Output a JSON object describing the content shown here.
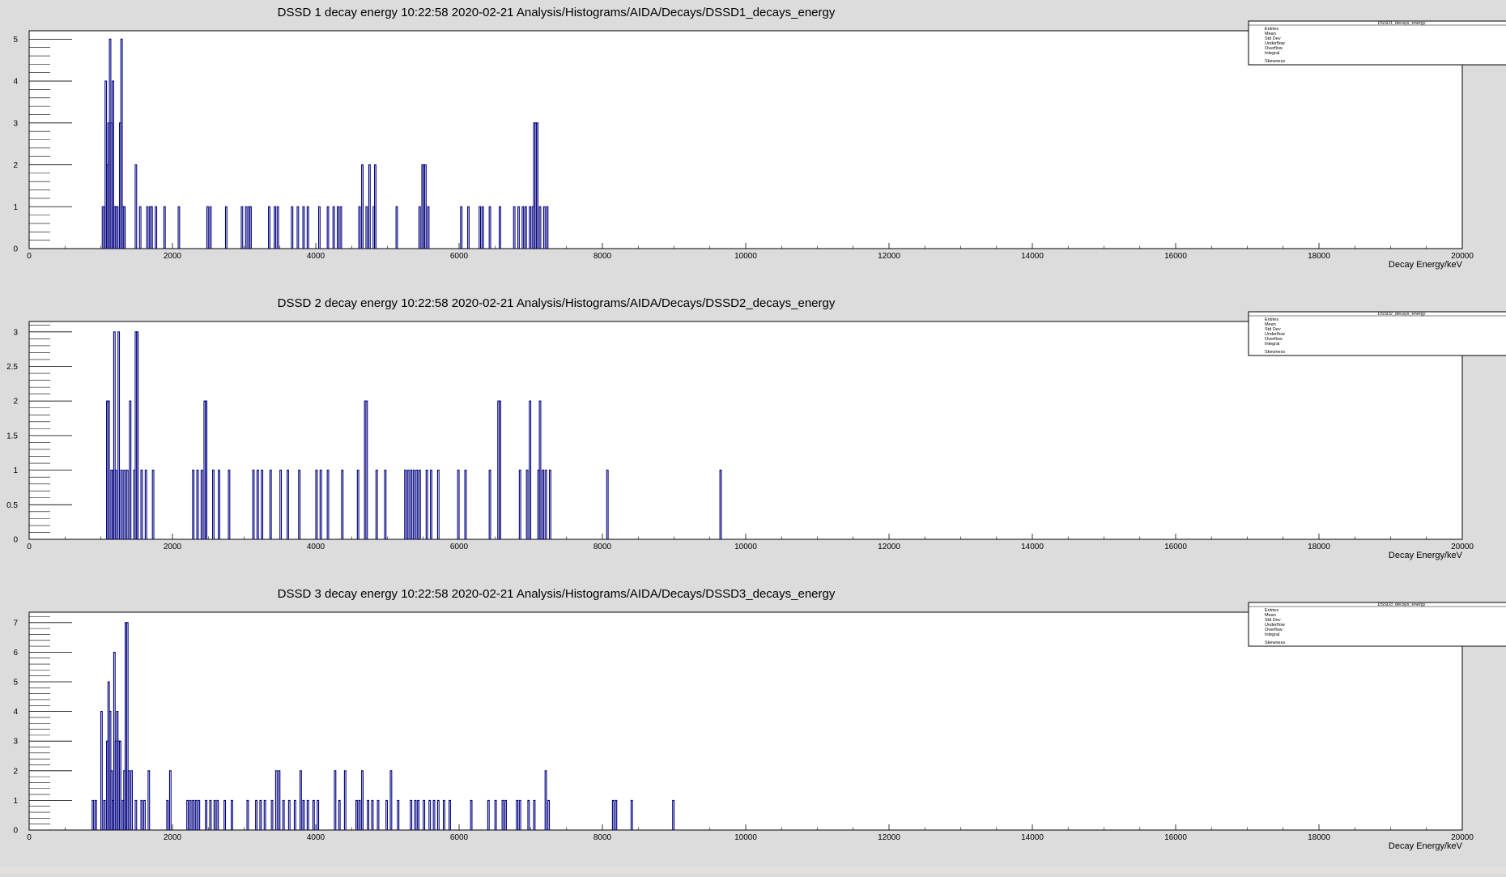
{
  "charts": [
    {
      "title": "DSSD 1 decay energy  10:22:58  2020-02-21  Analysis/Histograms/AIDA/Decays/DSSD1_decays_energy",
      "stats": {
        "name": "DSSD1_decays_energy",
        "labels": [
          "Entries",
          "Mean",
          "Std Dev",
          "Underflow",
          "Overflow",
          "Integral",
          "Skewness"
        ]
      },
      "xlabel": "Decay Energy/keV"
    },
    {
      "title": "DSSD 2 decay energy  10:22:58  2020-02-21  Analysis/Histograms/AIDA/Decays/DSSD2_decays_energy",
      "stats": {
        "name": "DSSD2_decays_energy",
        "labels": [
          "Entries",
          "Mean",
          "Std Dev",
          "Underflow",
          "Overflow",
          "Integral",
          "Skewness"
        ]
      },
      "xlabel": "Decay Energy/keV"
    },
    {
      "title": "DSSD 3 decay energy  10:22:58  2020-02-21  Analysis/Histograms/AIDA/Decays/DSSD3_decays_energy",
      "stats": {
        "name": "DSSD3_decays_energy",
        "labels": [
          "Entries",
          "Mean",
          "Std Dev",
          "Underflow",
          "Overflow",
          "Integral",
          "Skewness"
        ]
      },
      "xlabel": "Decay Energy/keV"
    }
  ],
  "chart_data": [
    {
      "type": "bar",
      "title": "DSSD 1 decay energy  10:22:58  2020-02-21  Analysis/Histograms/AIDA/Decays/DSSD1_decays_energy",
      "xlabel": "Decay Energy/keV",
      "ylabel": "",
      "xlim": [
        0,
        20000
      ],
      "ylim": [
        0,
        5.2
      ],
      "x_ticks": [
        0,
        2000,
        4000,
        6000,
        8000,
        10000,
        12000,
        14000,
        16000,
        18000,
        20000
      ],
      "y_ticks": [
        0,
        1,
        2,
        3,
        4,
        5
      ],
      "y_tick_labels": [
        "0",
        "1",
        "2",
        "3",
        "4",
        "5"
      ],
      "bin_width": 20,
      "color": "#000080",
      "bins": [
        [
          1020,
          1
        ],
        [
          1040,
          1
        ],
        [
          1060,
          4
        ],
        [
          1080,
          2
        ],
        [
          1100,
          3
        ],
        [
          1120,
          5
        ],
        [
          1140,
          3
        ],
        [
          1160,
          4
        ],
        [
          1180,
          1
        ],
        [
          1200,
          1
        ],
        [
          1220,
          1
        ],
        [
          1260,
          3
        ],
        [
          1280,
          5
        ],
        [
          1300,
          1
        ],
        [
          1320,
          1
        ],
        [
          1480,
          2
        ],
        [
          1540,
          1
        ],
        [
          1640,
          1
        ],
        [
          1680,
          1
        ],
        [
          1700,
          1
        ],
        [
          1760,
          1
        ],
        [
          1880,
          1
        ],
        [
          2080,
          1
        ],
        [
          2480,
          1
        ],
        [
          2520,
          1
        ],
        [
          2740,
          1
        ],
        [
          2960,
          1
        ],
        [
          3020,
          1
        ],
        [
          3060,
          1
        ],
        [
          3080,
          1
        ],
        [
          3340,
          1
        ],
        [
          3420,
          1
        ],
        [
          3460,
          1
        ],
        [
          3660,
          1
        ],
        [
          3740,
          1
        ],
        [
          3820,
          1
        ],
        [
          3880,
          1
        ],
        [
          4040,
          1
        ],
        [
          4160,
          1
        ],
        [
          4240,
          1
        ],
        [
          4300,
          1
        ],
        [
          4340,
          1
        ],
        [
          4600,
          1
        ],
        [
          4640,
          2
        ],
        [
          4700,
          1
        ],
        [
          4740,
          2
        ],
        [
          4800,
          1
        ],
        [
          4820,
          2
        ],
        [
          5120,
          1
        ],
        [
          5440,
          1
        ],
        [
          5480,
          2
        ],
        [
          5500,
          2
        ],
        [
          5520,
          2
        ],
        [
          5560,
          1
        ],
        [
          6020,
          1
        ],
        [
          6120,
          1
        ],
        [
          6280,
          1
        ],
        [
          6320,
          1
        ],
        [
          6420,
          1
        ],
        [
          6560,
          1
        ],
        [
          6760,
          1
        ],
        [
          6820,
          1
        ],
        [
          6880,
          1
        ],
        [
          6920,
          1
        ],
        [
          6980,
          1
        ],
        [
          7020,
          1
        ],
        [
          7040,
          3
        ],
        [
          7060,
          3
        ],
        [
          7080,
          3
        ],
        [
          7120,
          1
        ],
        [
          7180,
          1
        ],
        [
          7220,
          1
        ]
      ]
    },
    {
      "type": "bar",
      "title": "DSSD 2 decay energy  10:22:58  2020-02-21  Analysis/Histograms/AIDA/Decays/DSSD2_decays_energy",
      "xlabel": "Decay Energy/keV",
      "ylabel": "",
      "xlim": [
        0,
        20000
      ],
      "ylim": [
        0,
        3.15
      ],
      "x_ticks": [
        0,
        2000,
        4000,
        6000,
        8000,
        10000,
        12000,
        14000,
        16000,
        18000,
        20000
      ],
      "y_ticks": [
        0,
        0.5,
        1,
        1.5,
        2,
        2.5,
        3
      ],
      "y_tick_labels": [
        "0",
        "0.5",
        "1",
        "1.5",
        "2",
        "2.5",
        "3"
      ],
      "bin_width": 20,
      "color": "#000080",
      "bins": [
        [
          1080,
          2
        ],
        [
          1100,
          2
        ],
        [
          1140,
          1
        ],
        [
          1160,
          1
        ],
        [
          1180,
          3
        ],
        [
          1200,
          1
        ],
        [
          1240,
          3
        ],
        [
          1280,
          1
        ],
        [
          1320,
          1
        ],
        [
          1360,
          1
        ],
        [
          1400,
          2
        ],
        [
          1460,
          1
        ],
        [
          1480,
          3
        ],
        [
          1500,
          3
        ],
        [
          1560,
          1
        ],
        [
          1620,
          1
        ],
        [
          1720,
          1
        ],
        [
          2280,
          1
        ],
        [
          2340,
          1
        ],
        [
          2400,
          1
        ],
        [
          2440,
          2
        ],
        [
          2460,
          2
        ],
        [
          2560,
          1
        ],
        [
          2640,
          1
        ],
        [
          2780,
          1
        ],
        [
          3120,
          1
        ],
        [
          3180,
          1
        ],
        [
          3240,
          1
        ],
        [
          3360,
          1
        ],
        [
          3500,
          1
        ],
        [
          3600,
          1
        ],
        [
          3760,
          1
        ],
        [
          4000,
          1
        ],
        [
          4060,
          1
        ],
        [
          4160,
          1
        ],
        [
          4360,
          1
        ],
        [
          4580,
          1
        ],
        [
          4680,
          2
        ],
        [
          4700,
          2
        ],
        [
          4840,
          1
        ],
        [
          4960,
          1
        ],
        [
          5240,
          1
        ],
        [
          5280,
          1
        ],
        [
          5320,
          1
        ],
        [
          5360,
          1
        ],
        [
          5400,
          1
        ],
        [
          5440,
          1
        ],
        [
          5540,
          1
        ],
        [
          5600,
          1
        ],
        [
          5700,
          1
        ],
        [
          5980,
          1
        ],
        [
          6080,
          1
        ],
        [
          6420,
          1
        ],
        [
          6540,
          2
        ],
        [
          6560,
          2
        ],
        [
          6840,
          1
        ],
        [
          6940,
          1
        ],
        [
          6980,
          2
        ],
        [
          7100,
          1
        ],
        [
          7120,
          2
        ],
        [
          7160,
          1
        ],
        [
          7200,
          1
        ],
        [
          7260,
          1
        ],
        [
          8060,
          1
        ],
        [
          9640,
          1
        ]
      ]
    },
    {
      "type": "bar",
      "title": "DSSD 3 decay energy  10:22:58  2020-02-21  Analysis/Histograms/AIDA/Decays/DSSD3_decays_energy",
      "xlabel": "Decay Energy/keV",
      "ylabel": "",
      "xlim": [
        0,
        20000
      ],
      "ylim": [
        0,
        7.35
      ],
      "x_ticks": [
        0,
        2000,
        4000,
        6000,
        8000,
        10000,
        12000,
        14000,
        16000,
        18000,
        20000
      ],
      "y_ticks": [
        0,
        1,
        2,
        3,
        4,
        5,
        6,
        7
      ],
      "y_tick_labels": [
        "0",
        "1",
        "2",
        "3",
        "4",
        "5",
        "6",
        "7"
      ],
      "bin_width": 20,
      "color": "#000080",
      "bins": [
        [
          880,
          1
        ],
        [
          920,
          1
        ],
        [
          1000,
          4
        ],
        [
          1040,
          1
        ],
        [
          1080,
          3
        ],
        [
          1100,
          5
        ],
        [
          1120,
          4
        ],
        [
          1140,
          2
        ],
        [
          1160,
          1
        ],
        [
          1180,
          6
        ],
        [
          1200,
          3
        ],
        [
          1220,
          4
        ],
        [
          1240,
          3
        ],
        [
          1260,
          3
        ],
        [
          1300,
          1
        ],
        [
          1320,
          2
        ],
        [
          1340,
          7
        ],
        [
          1360,
          7
        ],
        [
          1380,
          2
        ],
        [
          1420,
          2
        ],
        [
          1480,
          1
        ],
        [
          1560,
          1
        ],
        [
          1600,
          1
        ],
        [
          1660,
          2
        ],
        [
          1920,
          1
        ],
        [
          1960,
          2
        ],
        [
          2200,
          1
        ],
        [
          2240,
          1
        ],
        [
          2280,
          1
        ],
        [
          2320,
          1
        ],
        [
          2360,
          1
        ],
        [
          2460,
          1
        ],
        [
          2520,
          1
        ],
        [
          2580,
          1
        ],
        [
          2620,
          1
        ],
        [
          2720,
          1
        ],
        [
          2820,
          1
        ],
        [
          3040,
          1
        ],
        [
          3160,
          1
        ],
        [
          3220,
          1
        ],
        [
          3280,
          1
        ],
        [
          3380,
          1
        ],
        [
          3440,
          2
        ],
        [
          3480,
          2
        ],
        [
          3540,
          1
        ],
        [
          3620,
          1
        ],
        [
          3700,
          1
        ],
        [
          3780,
          2
        ],
        [
          3820,
          1
        ],
        [
          3880,
          1
        ],
        [
          3960,
          1
        ],
        [
          4020,
          1
        ],
        [
          4260,
          2
        ],
        [
          4320,
          1
        ],
        [
          4400,
          2
        ],
        [
          4560,
          1
        ],
        [
          4600,
          1
        ],
        [
          4640,
          2
        ],
        [
          4720,
          1
        ],
        [
          4780,
          1
        ],
        [
          4860,
          1
        ],
        [
          4980,
          1
        ],
        [
          5040,
          2
        ],
        [
          5140,
          1
        ],
        [
          5320,
          1
        ],
        [
          5380,
          1
        ],
        [
          5420,
          1
        ],
        [
          5500,
          1
        ],
        [
          5580,
          1
        ],
        [
          5640,
          1
        ],
        [
          5700,
          1
        ],
        [
          5780,
          1
        ],
        [
          5860,
          1
        ],
        [
          6160,
          1
        ],
        [
          6400,
          1
        ],
        [
          6500,
          1
        ],
        [
          6600,
          1
        ],
        [
          6640,
          1
        ],
        [
          6800,
          1
        ],
        [
          6840,
          1
        ],
        [
          6960,
          1
        ],
        [
          7040,
          1
        ],
        [
          7200,
          2
        ],
        [
          7240,
          1
        ],
        [
          8140,
          1
        ],
        [
          8180,
          1
        ],
        [
          8400,
          1
        ],
        [
          8980,
          1
        ]
      ]
    }
  ]
}
